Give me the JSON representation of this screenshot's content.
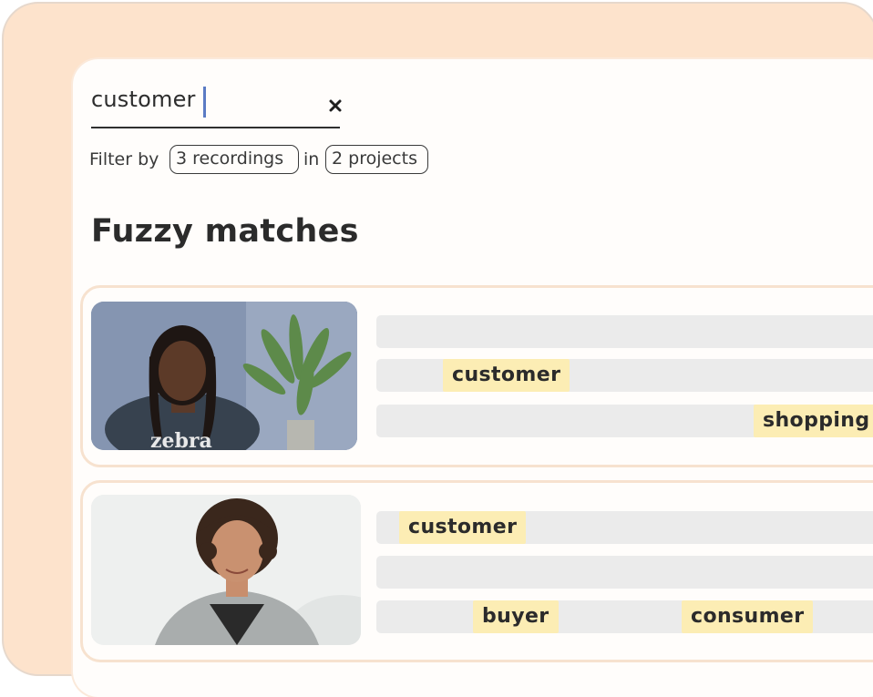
{
  "search": {
    "value": "customer"
  },
  "filter": {
    "label": "Filter by",
    "recordings": "3 recordings",
    "in": "in",
    "projects": "2 projects"
  },
  "section": {
    "title": "Fuzzy matches"
  },
  "results": [
    {
      "thumbnail_text": "zebra",
      "highlights": [
        "customer",
        "shopping"
      ]
    },
    {
      "highlights": [
        "customer",
        "buyer",
        "consumer"
      ]
    }
  ],
  "colors": {
    "background": "#fde3cc",
    "highlight": "#fcedb4",
    "caret": "#5b7bc4",
    "bar": "#ebebeb"
  },
  "icons": [
    "clear-icon"
  ]
}
